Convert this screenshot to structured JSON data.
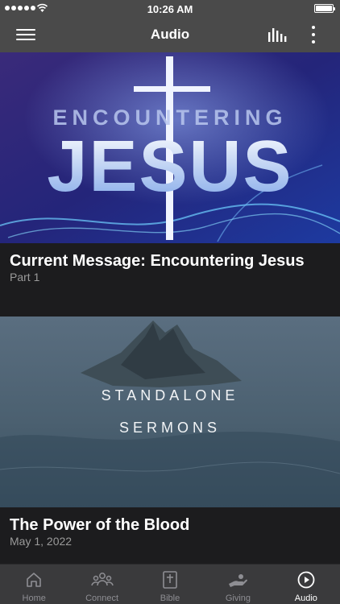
{
  "status_bar": {
    "time": "10:26 AM"
  },
  "navbar": {
    "title": "Audio"
  },
  "cards": [
    {
      "hero_text_top": "ENCOUNTERING",
      "hero_text_main": "JESUS",
      "title": "Current Message: Encountering Jesus",
      "subtitle": "Part 1"
    },
    {
      "hero_text_top": "STANDALONE",
      "hero_text_main": "SERMONS",
      "title": "The Power of the Blood",
      "subtitle": "May 1, 2022"
    }
  ],
  "tabs": [
    {
      "label": "Home",
      "icon": "home-icon"
    },
    {
      "label": "Connect",
      "icon": "people-icon"
    },
    {
      "label": "Bible",
      "icon": "bible-icon"
    },
    {
      "label": "Giving",
      "icon": "giving-hand-icon"
    },
    {
      "label": "Audio",
      "icon": "play-circle-icon",
      "active": true
    }
  ],
  "colors": {
    "bar_background": "#4a4a4a",
    "page_background": "#1c1c1e",
    "tabbar_background": "#3a3a3c",
    "inactive_tab": "#8e8e93",
    "active_tab": "#ffffff"
  }
}
